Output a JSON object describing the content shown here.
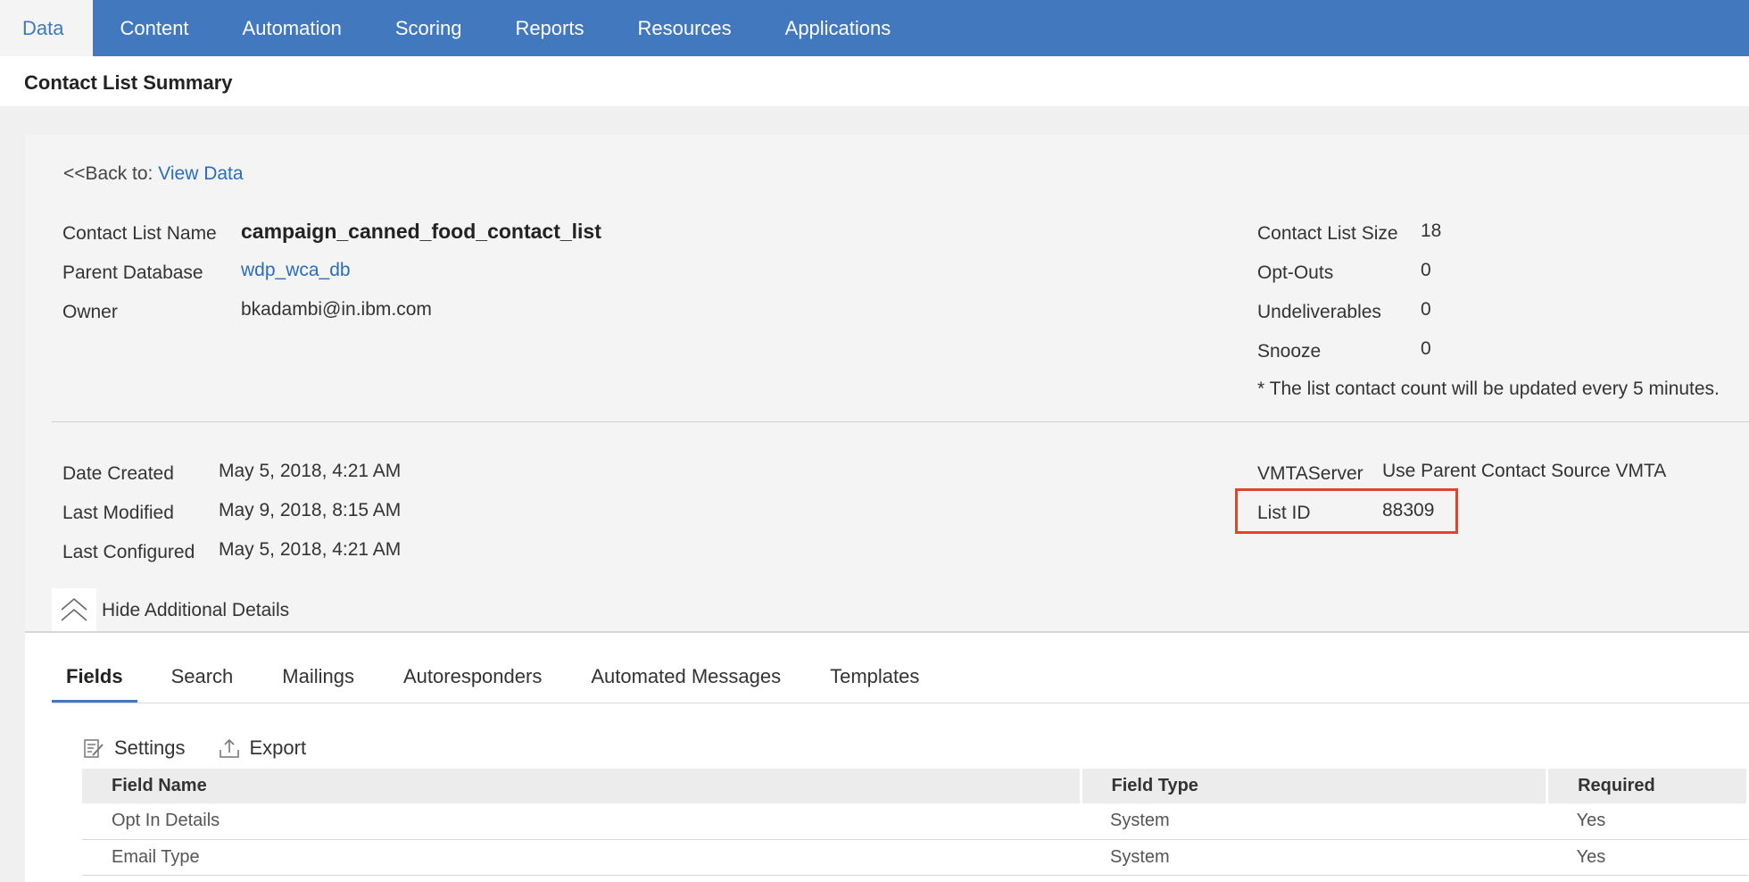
{
  "nav": {
    "tabs": [
      "Data",
      "Content",
      "Automation",
      "Scoring",
      "Reports",
      "Resources",
      "Applications"
    ],
    "active": "Data"
  },
  "page_title": "Contact List Summary",
  "back": {
    "prefix": "<<Back to: ",
    "link": "View Data"
  },
  "details_left": {
    "name_label": "Contact List Name",
    "name_value": "campaign_canned_food_contact_list",
    "parent_label": "Parent Database",
    "parent_value": "wdp_wca_db",
    "owner_label": "Owner",
    "owner_value": "bkadambi@in.ibm.com"
  },
  "details_right": {
    "size_label": "Contact List Size",
    "size_value": "18",
    "optouts_label": "Opt-Outs",
    "optouts_value": "0",
    "undeliverables_label": "Undeliverables",
    "undeliverables_value": "0",
    "snooze_label": "Snooze",
    "snooze_value": "0",
    "note": "* The list contact count will be updated every 5 minutes."
  },
  "dates": {
    "created_label": "Date Created",
    "created_value": "May 5, 2018, 4:21 AM",
    "modified_label": "Last Modified",
    "modified_value": "May 9, 2018, 8:15 AM",
    "configured_label": "Last Configured",
    "configured_value": "May 5, 2018, 4:21 AM"
  },
  "server": {
    "vmta_label": "VMTAServer",
    "vmta_value": "Use Parent Contact Source VMTA",
    "listid_label": "List ID",
    "listid_value": "88309"
  },
  "hide_details_label": "Hide Additional Details",
  "subtabs": [
    "Fields",
    "Search",
    "Mailings",
    "Autoresponders",
    "Automated Messages",
    "Templates"
  ],
  "toolbar": {
    "settings": "Settings",
    "export": "Export"
  },
  "table": {
    "headers": [
      "Field Name",
      "Field Type",
      "Required"
    ],
    "rows": [
      [
        "Opt In Details",
        "System",
        "Yes"
      ],
      [
        "Email Type",
        "System",
        "Yes"
      ]
    ]
  },
  "colors": {
    "nav_bg": "#4178be",
    "link": "#2a6ebb",
    "highlight": "#e0442a"
  }
}
